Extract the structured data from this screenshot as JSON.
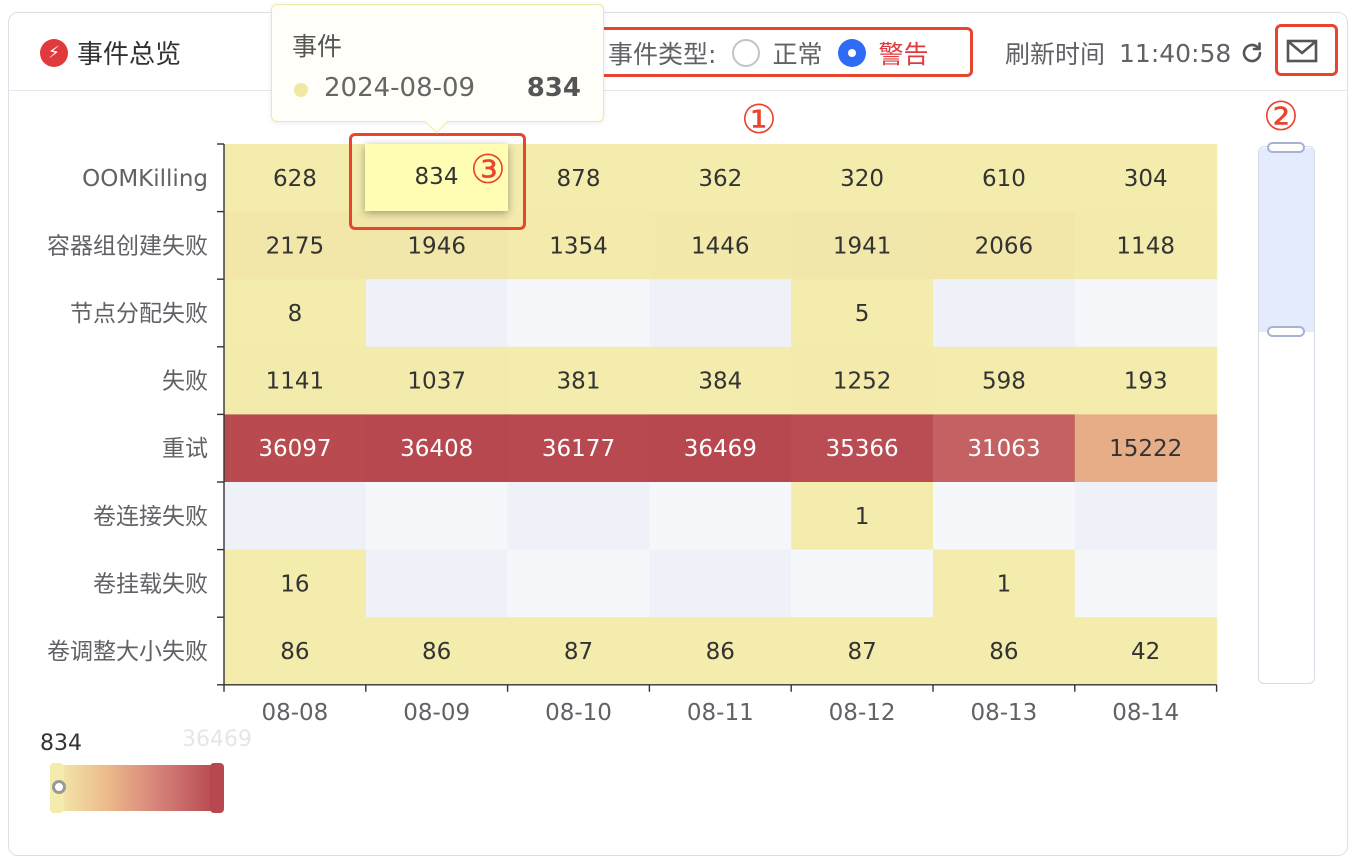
{
  "header": {
    "title": "事件总览",
    "title_icon": "lightning-bolt-icon",
    "filter_label": "事件类型:",
    "options": [
      {
        "label": "正常",
        "checked": false
      },
      {
        "label": "警告",
        "checked": true
      }
    ],
    "refresh_label": "刷新时间",
    "refresh_time": "11:40:58",
    "refresh_icon": "refresh-icon",
    "mail_icon": "mail-icon"
  },
  "callouts": [
    "①",
    "②",
    "③"
  ],
  "tooltip": {
    "title": "事件",
    "date": "2024-08-09",
    "value": "834"
  },
  "visual_map": {
    "min_label": "834",
    "max_label": "36469"
  },
  "colors": {
    "accent": "#2f6cf6",
    "warning": "#e0393e",
    "highlight": "#e8452f"
  },
  "chart_data": {
    "type": "heatmap",
    "x_categories": [
      "08-08",
      "08-09",
      "08-10",
      "08-11",
      "08-12",
      "08-13",
      "08-14"
    ],
    "y_categories": [
      "OOMKilling",
      "容器组创建失败",
      "节点分配失败",
      "失败",
      "重试",
      "卷连接失败",
      "卷挂载失败",
      "卷调整大小失败"
    ],
    "values": [
      [
        628,
        834,
        878,
        362,
        320,
        610,
        304
      ],
      [
        2175,
        1946,
        1354,
        1446,
        1941,
        2066,
        1148
      ],
      [
        8,
        null,
        null,
        null,
        5,
        null,
        null
      ],
      [
        1141,
        1037,
        381,
        384,
        1252,
        598,
        193
      ],
      [
        36097,
        36408,
        36177,
        36469,
        35366,
        31063,
        15222
      ],
      [
        null,
        null,
        null,
        null,
        1,
        null,
        null
      ],
      [
        16,
        null,
        null,
        null,
        null,
        1,
        null
      ],
      [
        86,
        86,
        87,
        86,
        87,
        86,
        42
      ]
    ],
    "visual_map_range": [
      834,
      36469
    ],
    "highlighted_cell": {
      "x": "08-09",
      "y": "OOMKilling"
    }
  }
}
